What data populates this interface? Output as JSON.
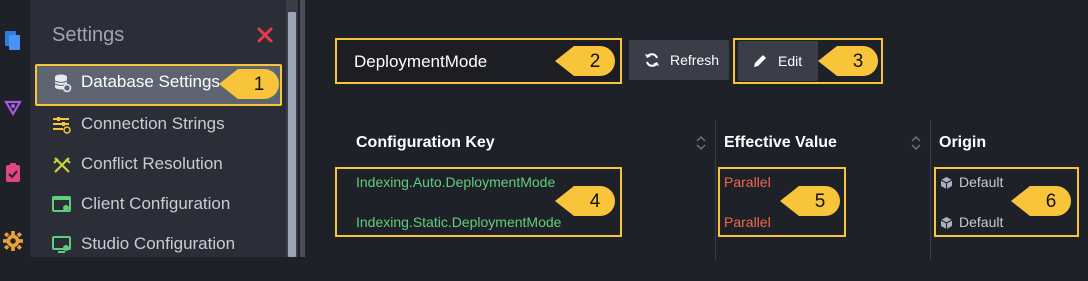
{
  "sidebar": {
    "title": "Settings",
    "items": [
      {
        "label": "Database Settings",
        "icon": "database-settings-icon"
      },
      {
        "label": "Connection Strings",
        "icon": "connection-strings-icon"
      },
      {
        "label": "Conflict Resolution",
        "icon": "conflict-resolution-icon"
      },
      {
        "label": "Client Configuration",
        "icon": "client-configuration-icon"
      },
      {
        "label": "Studio Configuration",
        "icon": "studio-configuration-icon"
      }
    ]
  },
  "main": {
    "search_value": "DeploymentMode",
    "refresh_label": "Refresh",
    "edit_label": "Edit",
    "columns": {
      "key": "Configuration Key",
      "value": "Effective Value",
      "origin": "Origin"
    },
    "rows": [
      {
        "key": "Indexing.Auto.DeploymentMode",
        "value": "Parallel",
        "origin": "Default"
      },
      {
        "key": "Indexing.Static.DeploymentMode",
        "value": "Parallel",
        "origin": "Default"
      }
    ]
  },
  "callouts": [
    "1",
    "2",
    "3",
    "4",
    "5",
    "6"
  ],
  "colors": {
    "accent": "#f8c53a",
    "key_text": "#5fcf7d",
    "value_text": "#f2664e",
    "background": "#1f2128"
  }
}
